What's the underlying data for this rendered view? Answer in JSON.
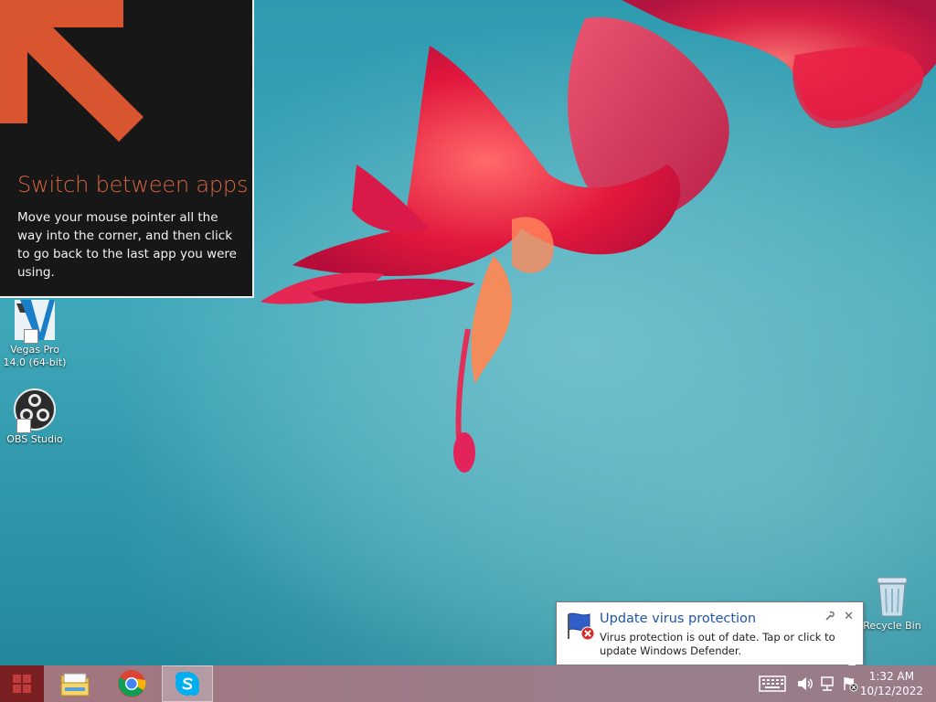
{
  "tip": {
    "title": "Switch between apps",
    "body": "Move your mouse pointer all the way into the corner, and then click to go back to the last app you were using.",
    "arrow_icon": "arrow-up-left-icon"
  },
  "desktop_icons": [
    {
      "label": "Vegas Pro 14.0 (64-bit)",
      "icon": "vegas-pro-icon"
    },
    {
      "label": "OBS Studio",
      "icon": "obs-studio-icon"
    },
    {
      "label": "Recycle Bin",
      "icon": "recycle-bin-icon"
    }
  ],
  "taskbar": {
    "pinned": [
      {
        "name": "start",
        "icon": "windows-start-icon"
      },
      {
        "name": "file-explorer",
        "icon": "folder-icon"
      },
      {
        "name": "chrome",
        "icon": "chrome-icon"
      },
      {
        "name": "skype",
        "icon": "skype-icon",
        "active": true
      }
    ],
    "tray": [
      "keyboard-icon",
      "volume-icon",
      "network-icon",
      "action-center-icon"
    ],
    "time": "1:32 AM",
    "date": "10/12/2022"
  },
  "notification": {
    "title": "Update virus protection",
    "text": "Virus protection is out of date. Tap or click to update Windows Defender.",
    "close": "✕"
  },
  "colors": {
    "tip_title": "#d9643f",
    "notification_title": "#1f56a8",
    "taskbar": "#9c7a86"
  }
}
